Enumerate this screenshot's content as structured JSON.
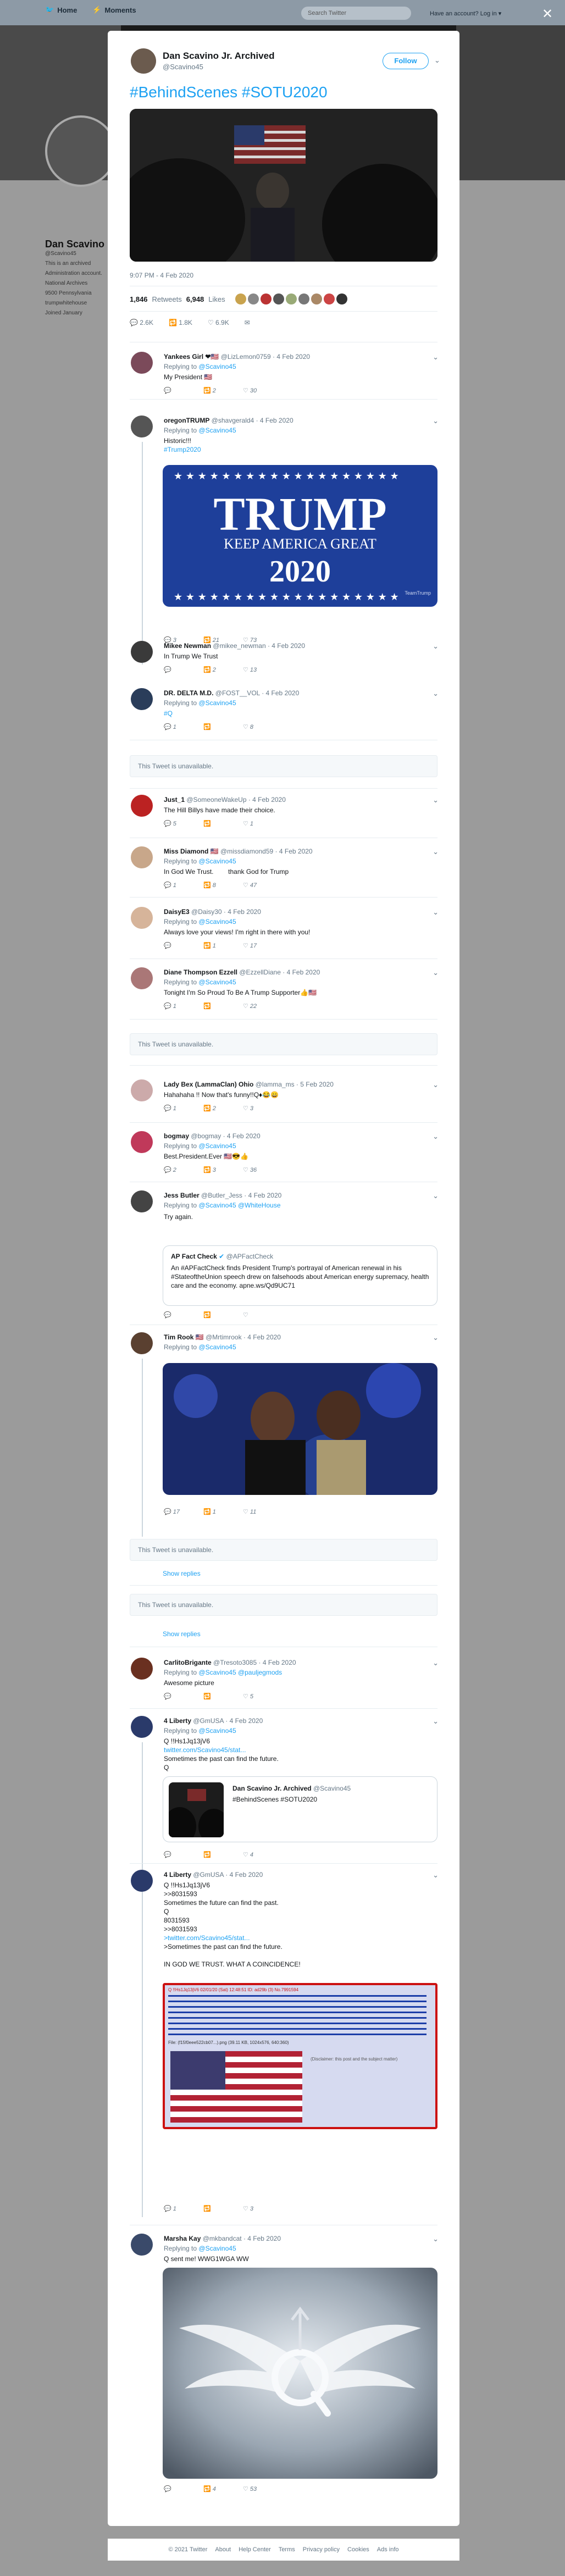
{
  "topnav": {
    "home": "Home",
    "moments": "Moments",
    "search_placeholder": "Search Twitter",
    "account": "Have an account? Log in ▾"
  },
  "bg_profile": {
    "name": "Dan Scavino",
    "handle": "@Scavino45",
    "bio": "This is an archived Administration account. National Archives",
    "joined": "9500 Pennsylvania",
    "link": "trumpwhitehouse",
    "label": "Joined January"
  },
  "main": {
    "name": "Dan Scavino Jr. Archived",
    "handle": "@Scavino45",
    "follow": "Follow",
    "text": "#BehindScenes #SOTU2020",
    "time": "9:07 PM - 4 Feb 2020",
    "retweets": "1,846",
    "retweets_label": "Retweets",
    "likes": "6,948",
    "likes_label": "Likes",
    "actions": {
      "reply": "2.6K",
      "retweet": "1.8K",
      "like": "6.9K"
    }
  },
  "replies": [
    {
      "name": "Yankees Girl ❤🇺🇸",
      "handle": "@LizLemon0759",
      "date": "4 Feb 2020",
      "replying": "@Scavino45",
      "lines": [
        "My President 🇺🇸"
      ],
      "acts": [
        "",
        "2",
        "30"
      ]
    },
    {
      "name": "oregonTRUMP",
      "handle": "@shavgerald4",
      "date": "4 Feb 2020",
      "replying": "@Scavino45",
      "lines": [
        "Historic!!!"
      ],
      "link": "#Trump2020",
      "acts": [
        "3",
        "21",
        "73"
      ]
    },
    {
      "name": "Mikee Newman",
      "handle": "@mikee_newman",
      "date": "4 Feb 2020",
      "lines": [
        "In Trump We Trust"
      ],
      "acts": [
        "",
        "2",
        "13"
      ]
    },
    {
      "name": "DR. DELTA M.D.",
      "handle": "@FOST__VOL",
      "date": "4 Feb 2020",
      "replying": "@Scavino45",
      "link": "#Q",
      "acts": [
        "1",
        "",
        "8"
      ]
    },
    {
      "name": "Just_1",
      "handle": "@SomeoneWakeUp",
      "date": "4 Feb 2020",
      "lines": [
        "The Hill Billys have made their choice."
      ],
      "acts": [
        "5",
        "",
        "1"
      ]
    },
    {
      "name": "Miss Diamond 🇺🇸",
      "handle": "@missdiamond59",
      "date": "4 Feb 2020",
      "replying": "@Scavino45",
      "lines": [
        "In God We Trust.",
        "thank God for Trump"
      ],
      "acts": [
        "1",
        "8",
        "47"
      ]
    },
    {
      "name": "DaisyE3",
      "handle": "@Daisy30",
      "date": "4 Feb 2020",
      "replying": "@Scavino45",
      "lines": [
        "Always love your views! I'm right in there with you!"
      ],
      "acts": [
        "",
        "1",
        "17"
      ]
    },
    {
      "name": "Diane Thompson Ezzell",
      "handle": "@EzzellDiane",
      "date": "4 Feb 2020",
      "replying": "@Scavino45",
      "lines": [
        "Tonight I'm So Proud To Be A Trump Supporter👍🇺🇸"
      ],
      "acts": [
        "1",
        "",
        "22"
      ]
    },
    {
      "name": "Lady Bex (LammaClan) Ohio",
      "handle": "@lamma_ms",
      "date": "5 Feb 2020",
      "lines": [
        "Hahahaha !! Now that's funny!!Q♦😂😄"
      ],
      "acts": [
        "1",
        "2",
        "3"
      ]
    },
    {
      "name": "bogmay",
      "handle": "@bogmay",
      "date": "4 Feb 2020",
      "replying": "@Scavino45",
      "lines": [
        "Best.President.Ever 🇺🇸😎👍"
      ],
      "acts": [
        "2",
        "3",
        "36"
      ]
    },
    {
      "name": "Jess Butler",
      "handle": "@Butler_Jess",
      "date": "4 Feb 2020",
      "replying": "@Scavino45 @WhiteHouse",
      "lines": [
        "Try again."
      ],
      "acts": [
        "",
        "",
        ""
      ]
    },
    {
      "name": "Tim Rook 🇺🇸",
      "handle": "@Mrtimrook",
      "date": "4 Feb 2020",
      "replying": "@Scavino45",
      "acts": [
        "17",
        "1",
        "11"
      ]
    },
    {
      "name": "CarlitoBrigante",
      "handle": "@Tresoto3085",
      "date": "4 Feb 2020",
      "replying": "@Scavino45 @pauljegmods",
      "lines": [
        "Awesome picture"
      ],
      "acts": [
        "",
        "",
        "5"
      ]
    },
    {
      "name": "4 Liberty",
      "handle": "@GmUSA",
      "date": "4 Feb 2020",
      "replying": "@Scavino45",
      "lines": [
        "Q !!Hs1Jq13jV6"
      ],
      "link": "twitter.com/Scavino45/stat...",
      "lines2": [
        "Sometimes the past can find the future.",
        "Q"
      ],
      "acts": [
        "",
        "",
        "4"
      ]
    },
    {
      "name": "4 Liberty",
      "handle": "@GmUSA",
      "date": "4 Feb 2020",
      "lines": [
        "Q !!Hs1Jq13jV6",
        ">>8031593",
        "Sometimes the future can find the past.",
        "Q",
        "8031593",
        ">>8031593",
        ""
      ],
      "link": ">twitter.com/Scavino45/stat...",
      "lines2": [
        ">Sometimes the past can find the future.",
        "",
        "IN GOD WE TRUST. WHAT A COINCIDENCE!"
      ],
      "acts": [
        "1",
        "",
        "3"
      ]
    },
    {
      "name": "Marsha Kay",
      "handle": "@mkbandcat",
      "date": "4 Feb 2020",
      "replying": "@Scavino45",
      "lines": [
        "Q sent me!  WWG1WGA WW"
      ],
      "acts": [
        "",
        "4",
        "53"
      ]
    }
  ],
  "unavailable": "This Tweet is unavailable.",
  "show_replies": "Show replies",
  "replying_to": "Replying to",
  "trump_sign": {
    "title": "TRUMP",
    "sub": "KEEP AMERICA GREAT",
    "year": "2020",
    "credit": "TeamTrump"
  },
  "quote_factcheck": {
    "name": "AP Fact Check",
    "handle": "@APFactCheck",
    "text": "An #APFactCheck finds President Trump's portrayal of American renewal in his #StateoftheUnion speech drew on falsehoods about American energy supremacy, health care and the economy. apne.ws/Qd9UC71"
  },
  "quote_dan": {
    "name": "Dan Scavino Jr. Archived",
    "handle": "@Scavino45",
    "text": "#BehindScenes #SOTU2020"
  },
  "qpost": {
    "header": "Q !!Hs1Jq13jV6   02/01/20 (Sat) 12:48:51 ID: ad29b (3)  No.7991594",
    "file": "File: (f15f0eee522cb07...).png (39.11 KB, 1024x576, 640:360)",
    "caption": "(Disclaimer: this post and the subject matter)"
  },
  "footer": [
    "© 2021 Twitter",
    "About",
    "Help Center",
    "Terms",
    "Privacy policy",
    "Cookies",
    "Ads info"
  ],
  "colors": {
    "accent": "#1da1f2",
    "trump_blue": "#1e3f9a",
    "q_red": "#cc1111"
  }
}
